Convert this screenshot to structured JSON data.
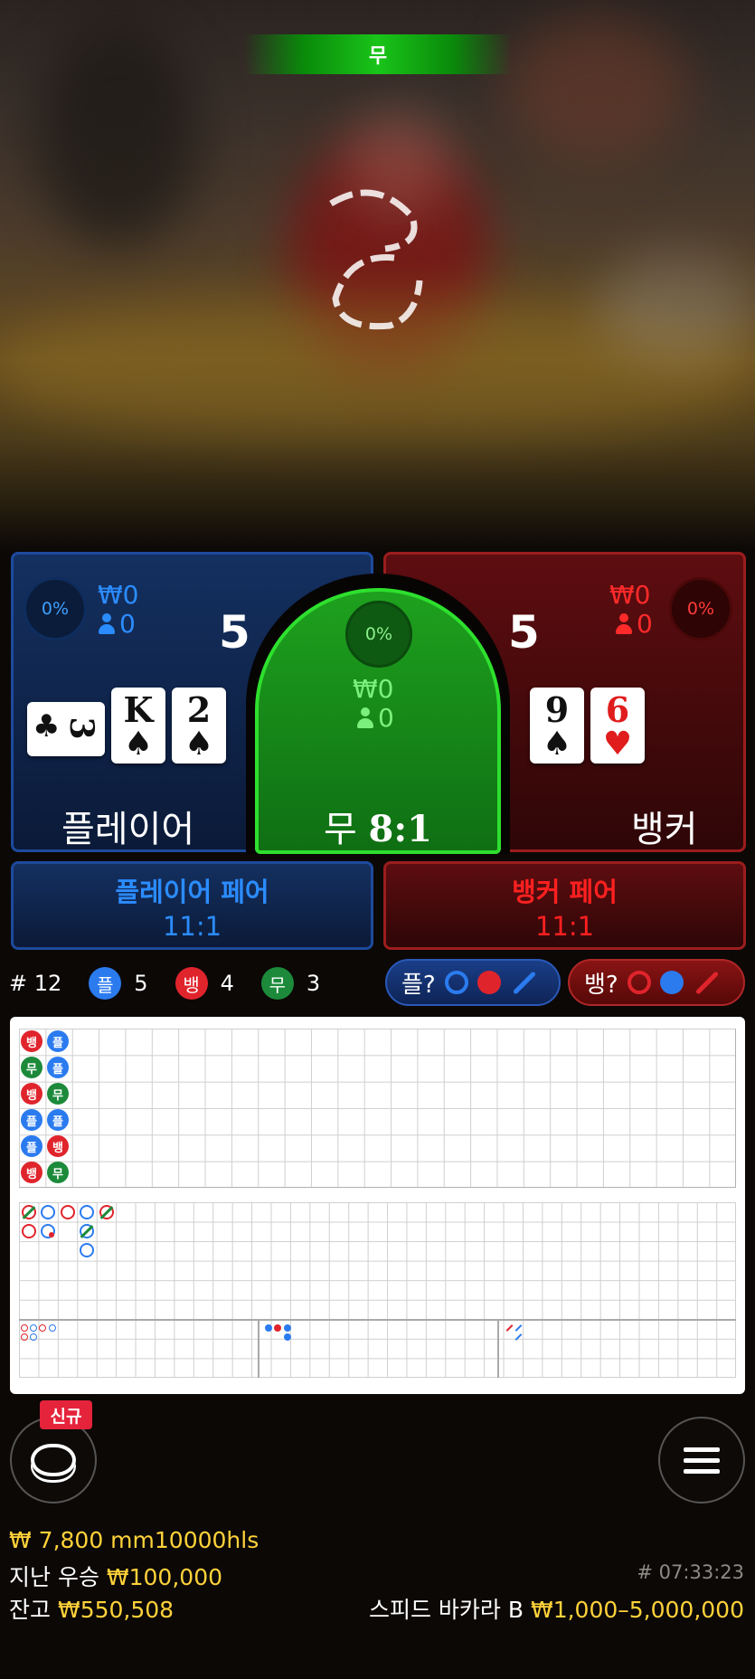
{
  "video": {
    "result_banner": "무"
  },
  "player": {
    "percent": "0%",
    "bet_amount": "₩0",
    "bettors": "0",
    "score": "5",
    "label": "플레이어",
    "cards": [
      {
        "rank": "3",
        "suit": "♣",
        "color": "black",
        "orientation": "sideways"
      },
      {
        "rank": "K",
        "suit": "♠",
        "color": "black"
      },
      {
        "rank": "2",
        "suit": "♠",
        "color": "black"
      }
    ]
  },
  "tie": {
    "percent": "0%",
    "bet_amount": "₩0",
    "bettors": "0",
    "label": "무",
    "payout": "8:1"
  },
  "banker": {
    "percent": "0%",
    "bet_amount": "₩0",
    "bettors": "0",
    "score": "5",
    "label": "뱅커",
    "cards": [
      {
        "rank": "9",
        "suit": "♠",
        "color": "black"
      },
      {
        "rank": "6",
        "suit": "♥",
        "color": "red"
      }
    ]
  },
  "player_pair": {
    "label": "플레이어 페어",
    "payout": "11:1"
  },
  "banker_pair": {
    "label": "뱅커 페어",
    "payout": "11:1"
  },
  "counts": {
    "round": "# 12",
    "player": {
      "badge": "플",
      "value": "5"
    },
    "banker": {
      "badge": "뱅",
      "value": "4"
    },
    "tie": {
      "badge": "무",
      "value": "3"
    }
  },
  "predict": {
    "player": "플?",
    "banker": "뱅?"
  },
  "bead_road": {
    "columns": [
      [
        "뱅",
        "무",
        "뱅",
        "플",
        "플",
        "뱅"
      ],
      [
        "플",
        "플",
        "무",
        "플",
        "뱅",
        "무"
      ]
    ]
  },
  "colors": {
    "player": "#2b7bef",
    "banker": "#e0242c",
    "tie": "#1c8a3a",
    "gold": "#ffd23a"
  },
  "chip_button": {
    "badge": "신규",
    "icon": "chip-icon"
  },
  "menu_button": {
    "icon": "hamburger-menu-icon"
  },
  "footer": {
    "bet_line": "₩ 7,800 mm10000hls",
    "last_win_label": "지난 우승",
    "last_win_value": "₩100,000",
    "balance_label": "잔고",
    "balance_value": "₩550,508",
    "game_id": "# 07:33:23",
    "table_name": "스피드 바카라 B",
    "table_limits": "₩1,000–5,000,000"
  }
}
